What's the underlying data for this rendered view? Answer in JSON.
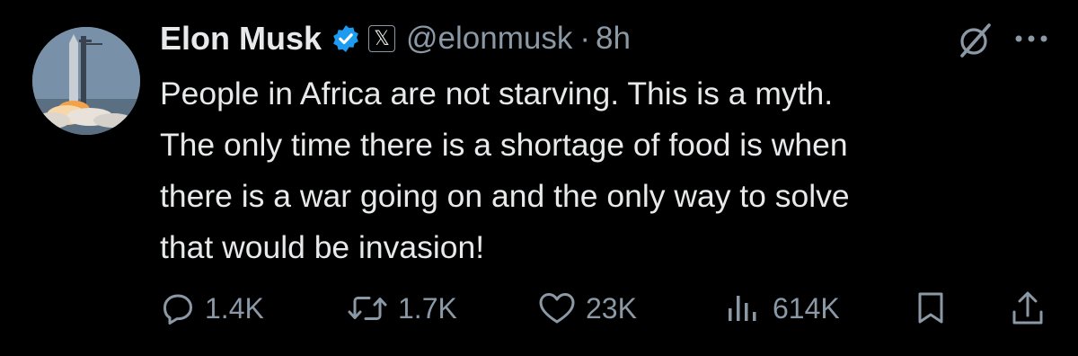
{
  "author": {
    "name": "Elon Musk",
    "handle": "@elonmusk",
    "separator": "·",
    "time": "8h",
    "affiliation_glyph": "𝕏",
    "verified_color": "#1d9bf0"
  },
  "tweet": {
    "lines": [
      "People in Africa are not starving. This is a myth.",
      "The only time there is a shortage of food is when",
      "there is a war going on and the only way to solve",
      "that would be invasion!"
    ]
  },
  "actions": {
    "replies": "1.4K",
    "reposts": "1.7K",
    "likes": "23K",
    "views": "614K"
  },
  "icons": {
    "reply": "reply-icon",
    "repost": "repost-icon",
    "like": "heart-icon",
    "views": "views-icon",
    "bookmark": "bookmark-icon",
    "share": "share-icon",
    "grok": "grok-icon",
    "more": "more-icon"
  },
  "colors": {
    "background": "#000000",
    "text": "#e7e9ea",
    "muted": "#8b98a5"
  }
}
